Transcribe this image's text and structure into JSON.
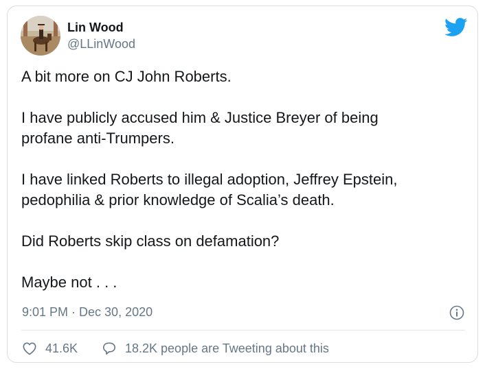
{
  "tweet": {
    "author_name": "Lin Wood",
    "author_handle": "@LLinWood",
    "paragraphs": [
      "A bit more on CJ John Roberts.",
      "I have publicly accused him & Justice Breyer of being profane anti-Trumpers.",
      "I have linked Roberts to illegal adoption, Jeffrey Epstein, pedophilia & prior knowledge of Scalia’s death.",
      "Did Roberts skip class on defamation?",
      "Maybe not . . ."
    ],
    "timestamp": "9:01 PM · Dec 30, 2020",
    "likes": "41.6K",
    "talking_about": "18.2K people are Tweeting about this"
  },
  "icons": {
    "brand": "twitter-bird-icon",
    "info": "info-icon",
    "like": "heart-icon",
    "talk": "speech-bubble-icon"
  },
  "colors": {
    "brand": "#1da1f2",
    "text": "#14171a",
    "secondary": "#657786",
    "border": "#d7dde2"
  }
}
